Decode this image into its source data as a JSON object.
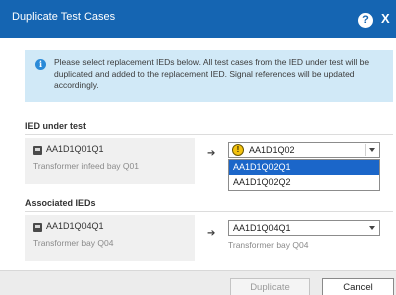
{
  "dialog": {
    "title": "Duplicate Test Cases",
    "help_glyph": "?",
    "close_glyph": "X"
  },
  "info": {
    "icon_glyph": "i",
    "message": "Please select replacement IEDs below. All test cases from the IED under test will be duplicated and added to the replacement IED. Signal references will be updated accordingly."
  },
  "ied_under_test": {
    "section_label": "IED under test",
    "source_name": "AA1D1Q01Q1",
    "source_desc": "Transformer infeed bay Q01",
    "arrow": "➔",
    "warning_glyph": "!",
    "selected_value": "AA1D1Q02",
    "options": [
      "AA1D1Q02Q1",
      "AA1D1Q02Q2"
    ],
    "highlighted_option": "AA1D1Q02Q1"
  },
  "associated_ieds": {
    "section_label": "Associated IEDs",
    "source_name": "AA1D1Q04Q1",
    "source_desc": "Transformer bay Q04",
    "arrow": "➔",
    "selected_value": "AA1D1Q04Q1",
    "target_desc": "Transformer bay Q04"
  },
  "footer": {
    "duplicate_label": "Duplicate",
    "cancel_label": "Cancel"
  },
  "colors": {
    "title_bar": "#1565b2",
    "info_bg": "#d1e9f7",
    "selection": "#1b66c9",
    "warning": "#f4c20d"
  },
  "icons": {
    "help": "help-icon",
    "close": "close-icon",
    "info": "info-icon",
    "ied": "ied-device-icon",
    "arrow": "arrow-right-icon",
    "warning": "warning-icon",
    "dropdown": "chevron-down-icon"
  }
}
